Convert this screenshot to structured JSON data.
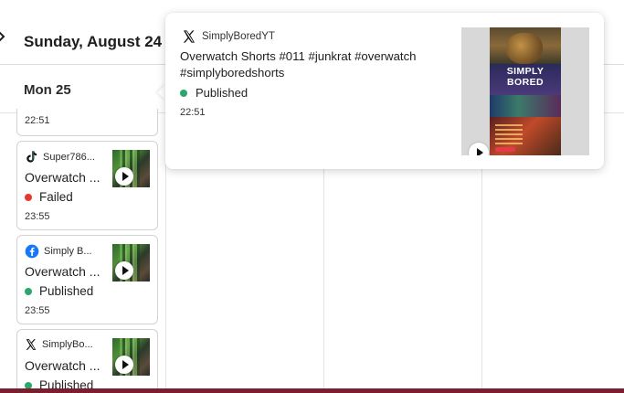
{
  "header": {
    "date_title": "Sunday, August 24 –"
  },
  "columns": {
    "day_label": "Mon 25"
  },
  "cards": [
    {
      "time": "22:51"
    },
    {
      "network": "tiktok",
      "account": "Super786...",
      "title": "Overwatch ...",
      "status": "Failed",
      "status_color": "#e23a2e",
      "time": "23:55"
    },
    {
      "network": "facebook",
      "account": "Simply B...",
      "title": "Overwatch ...",
      "status": "Published",
      "status_color": "#2aa86b",
      "time": "23:55"
    },
    {
      "network": "x",
      "account": "SimplyBo...",
      "title": "Overwatch ...",
      "status": "Published",
      "status_color": "#2aa86b"
    }
  ],
  "popover": {
    "network": "x",
    "account": "SimplyBoredYT",
    "title": "Overwatch Shorts #011 #junkrat #overwatch #simplyboredshorts",
    "status": "Published",
    "status_color": "#2aa86b",
    "time": "22:51",
    "thumb_brand": "SIMPLY BORED"
  },
  "icons": {
    "back": "chevron-left-icon",
    "tiktok": "tiktok-icon",
    "facebook": "facebook-icon",
    "x": "x-logo-icon",
    "play": "play-icon"
  },
  "colors": {
    "accent_bottom": "#7a1f2e",
    "published": "#2aa86b",
    "failed": "#e23a2e"
  }
}
